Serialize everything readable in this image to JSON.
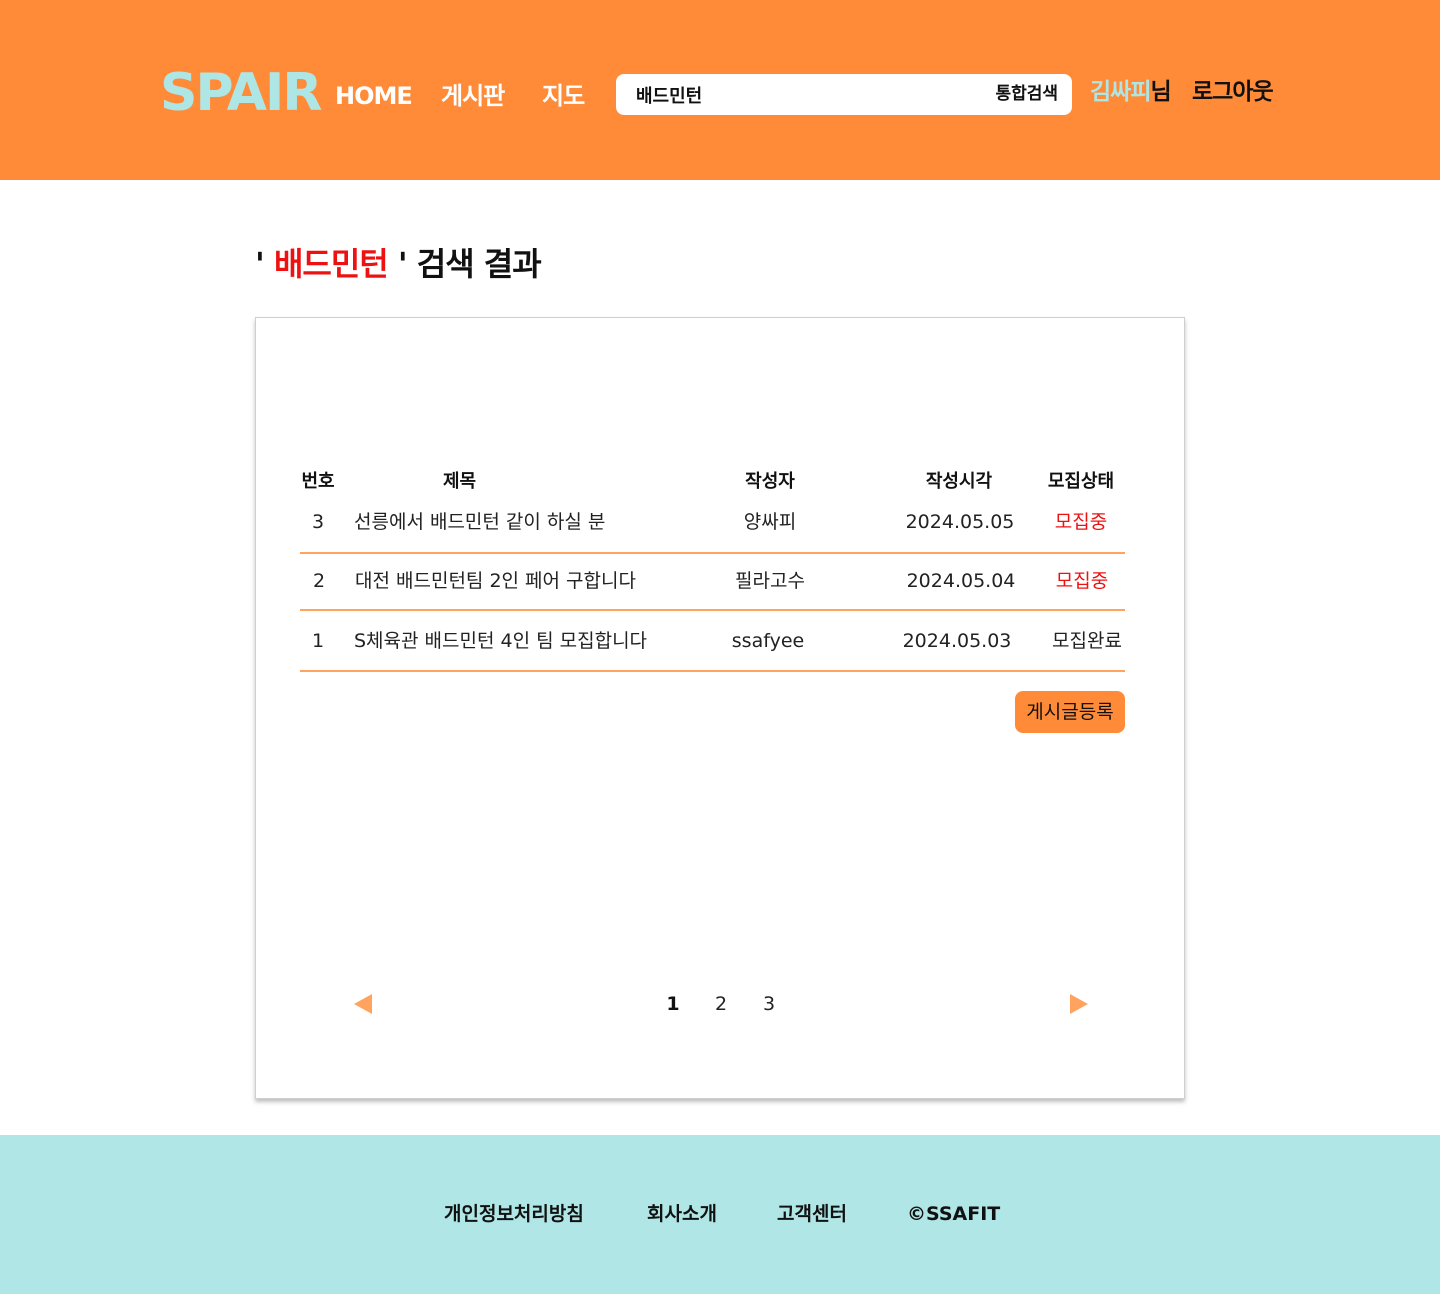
{
  "header": {
    "logo": "SPAIR",
    "nav": {
      "home": "HOME",
      "board": "게시판",
      "map": "지도"
    },
    "search": {
      "value": "배드민턴",
      "button_label": "통합검색"
    },
    "user": {
      "name": "김싸피",
      "suffix": "님"
    },
    "logout_label": "로그아웃"
  },
  "result": {
    "quote_open": "' ",
    "keyword": "배드민턴",
    "quote_close": " ' 검색 결과"
  },
  "table": {
    "headers": {
      "num": "번호",
      "title": "제목",
      "author": "작성자",
      "time": "작성시각",
      "status": "모집상태"
    },
    "rows": [
      {
        "num": "3",
        "title": "선릉에서 배드민턴 같이 하실 분",
        "author": "양싸피",
        "date": "2024.05.05",
        "status": "모집중"
      },
      {
        "num": "2",
        "title": "대전 배드민턴팀 2인 페어 구합니다",
        "author": "필라고수",
        "date": "2024.05.04",
        "status": "모집중"
      },
      {
        "num": "1",
        "title": "S체육관 배드민턴 4인 팀 모집합니다",
        "author": "ssafyee",
        "date": "2024.05.03",
        "status": "모집완료"
      }
    ]
  },
  "write_button": "게시글등록",
  "pagination": {
    "pages": [
      "1",
      "2",
      "3"
    ],
    "current": "1"
  },
  "footer": {
    "links": [
      "개인정보처리방침",
      "회사소개",
      "고객센터",
      "©SSAFIT"
    ]
  },
  "colors": {
    "header_bg": "#ff8b38",
    "accent_mint": "#aee6e6",
    "keyword_red": "#ee1111",
    "footer_bg": "#b0e6e6",
    "row_divider": "#ffa35e"
  }
}
